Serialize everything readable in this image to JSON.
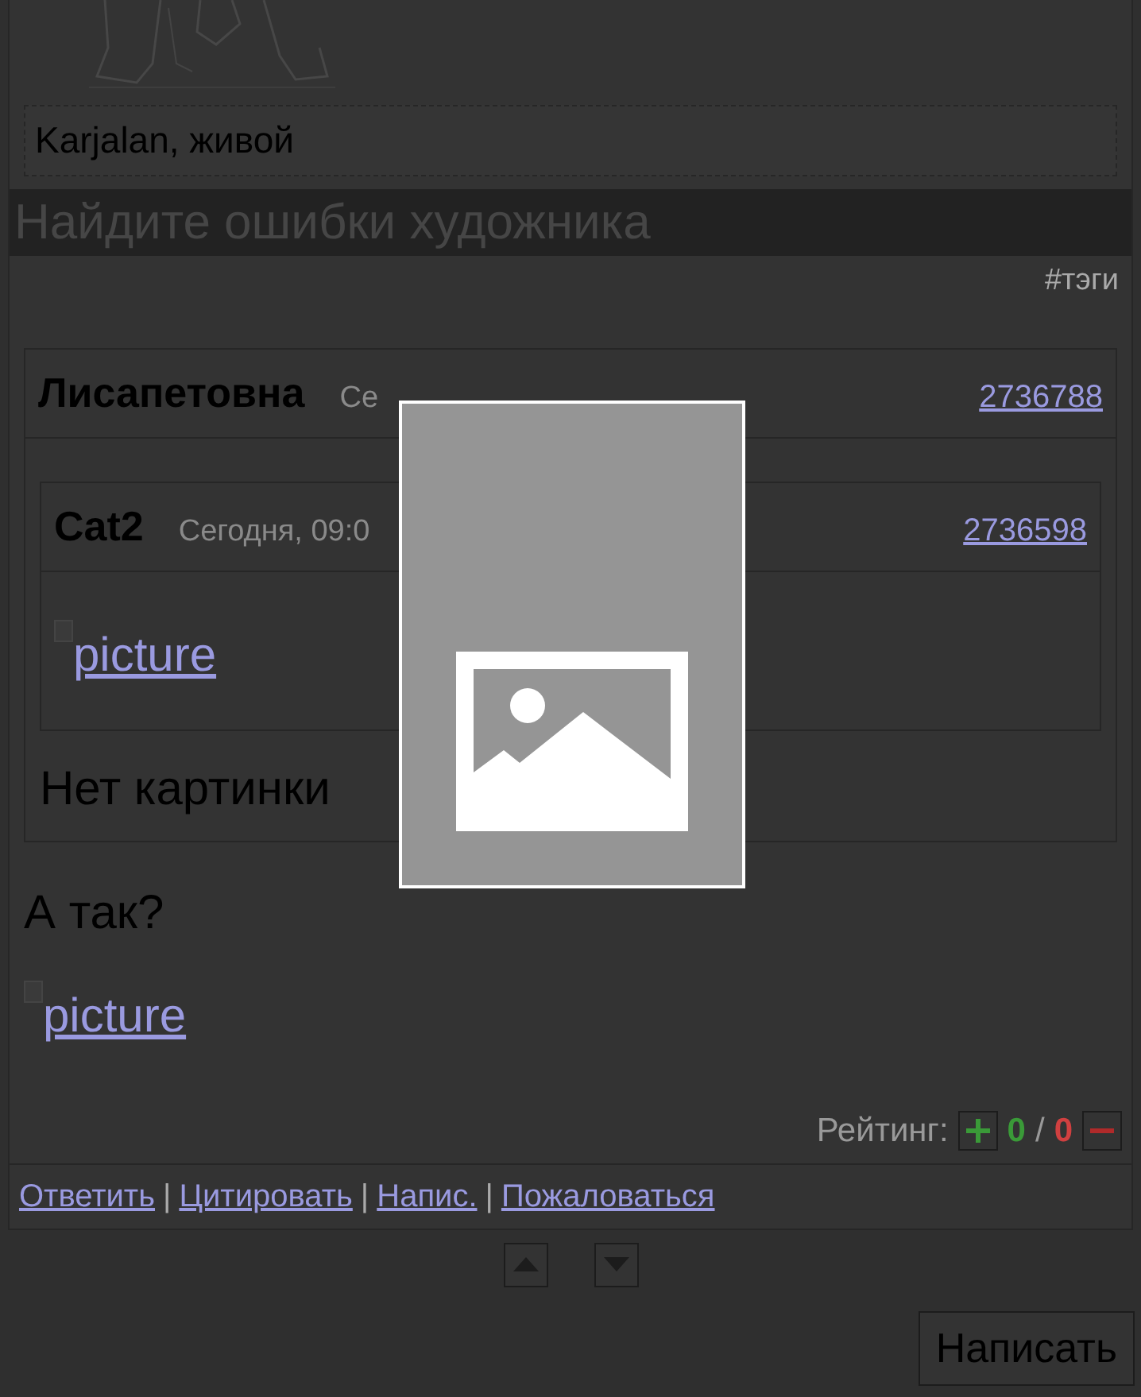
{
  "caption": "Karjalan, живой",
  "title": "Найдите ошибки художника",
  "tags_link": "#тэги",
  "comment": {
    "quoted": {
      "author": "Лисапетовна",
      "date": "Се",
      "id": "2736788",
      "quoted": {
        "author": "Cat2",
        "date": "Сегодня, 09:0",
        "id": "2736598",
        "image_alt": "picture"
      },
      "text": "Нет картинки"
    },
    "text": "А так?",
    "image_alt": "picture",
    "rating": {
      "label": "Рейтинг:",
      "up": "0",
      "separator": "/",
      "down": "0"
    },
    "actions": [
      {
        "label": "Ответить"
      },
      {
        "label": "Цитировать"
      },
      {
        "label": "Напис."
      },
      {
        "label": "Пожаловаться"
      }
    ],
    "action_separator": "|"
  },
  "nav_buttons": [
    {
      "kind": "up"
    },
    {
      "kind": "down"
    }
  ],
  "write_button": "Написать",
  "lightbox": {
    "kind": "image-placeholder"
  }
}
